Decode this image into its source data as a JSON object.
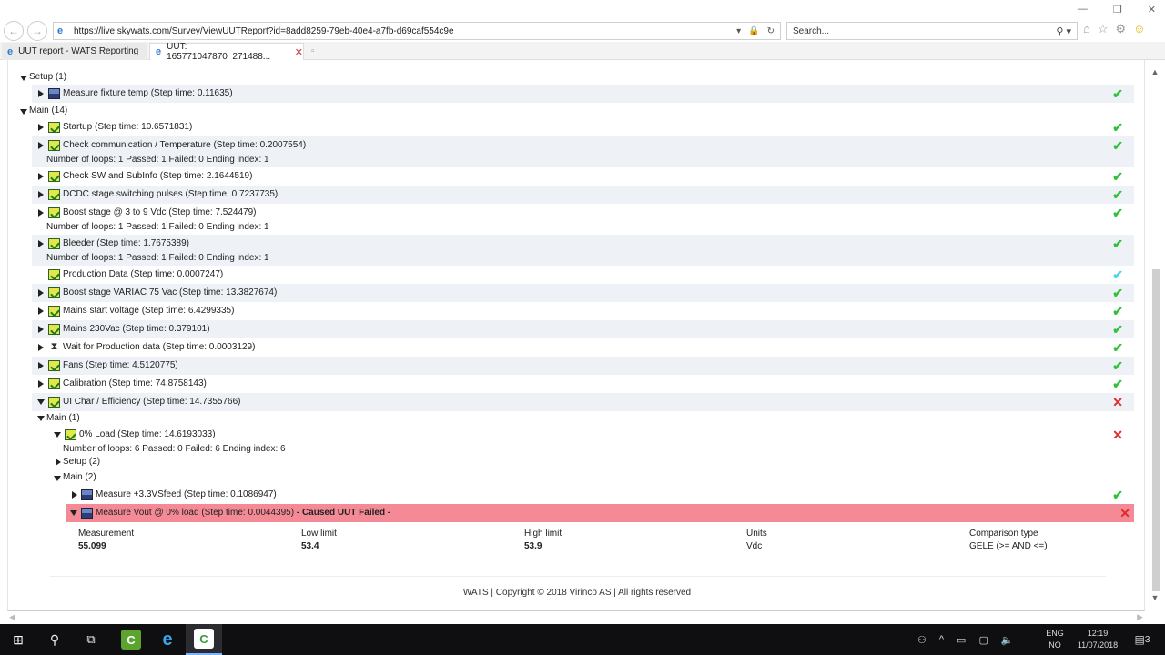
{
  "browser": {
    "url": "https://live.skywats.com/Survey/ViewUUTReport?id=8add8259-79eb-40e4-a7fb-d69caf554c9e",
    "search_placeholder": "Search...",
    "tabs": [
      {
        "label": "UUT report - WATS Reporting"
      },
      {
        "label": "UUT: 165771047870_271488..."
      }
    ]
  },
  "tree": {
    "setup_group": "Setup (1)",
    "setup_steps": [
      {
        "label": "Measure fixture temp (Step time: 0.11635)",
        "status": "passed"
      }
    ],
    "main_group": "Main (14)",
    "main_steps": [
      {
        "label": "Startup (Step time: 10.6571831)",
        "status": "passed"
      },
      {
        "label": "Check communication / Temperature (Step time: 0.2007554)",
        "status": "passed",
        "detail": "Number of loops: 1 Passed: 1 Failed: 0 Ending index: 1"
      },
      {
        "label": "Check SW and SubInfo (Step time: 2.1644519)",
        "status": "passed"
      },
      {
        "label": "DCDC stage switching pulses (Step time: 0.7237735)",
        "status": "passed"
      },
      {
        "label": "Boost stage @ 3 to 9 Vdc (Step time: 7.524479)",
        "status": "passed",
        "detail": "Number of loops: 1 Passed: 1 Failed: 0 Ending index: 1"
      },
      {
        "label": "Bleeder (Step time: 1.7675389)",
        "status": "passed",
        "detail": "Number of loops: 1 Passed: 1 Failed: 0 Ending index: 1"
      },
      {
        "label": "Production Data (Step time: 0.0007247)",
        "status": "done"
      },
      {
        "label": "Boost stage VARIAC 75 Vac (Step time: 13.3827674)",
        "status": "passed"
      },
      {
        "label": "Mains start voltage (Step time: 6.4299335)",
        "status": "passed"
      },
      {
        "label": "Mains 230Vac (Step time: 0.379101)",
        "status": "passed"
      },
      {
        "label": "Wait for Production data (Step time: 0.0003129)",
        "status": "passed"
      },
      {
        "label": "Fans (Step time: 4.5120775)",
        "status": "passed"
      },
      {
        "label": "Calibration (Step time: 74.8758143)",
        "status": "passed"
      },
      {
        "label": "UI Char / Efficiency (Step time: 14.7355766)",
        "status": "failed"
      }
    ],
    "nested": {
      "main_group": "Main (1)",
      "load_step": {
        "label": "0% Load (Step time: 14.6193033)",
        "status": "failed",
        "detail": "Number of loops: 6 Passed: 0 Failed: 6 Ending index: 6"
      },
      "setup_group": "Setup (2)",
      "inner_main_group": "Main (2)",
      "measure_33": {
        "label": "Measure +3.3VSfeed (Step time: 0.1086947)",
        "status": "passed"
      },
      "measure_vout": {
        "label": "Measure Vout @ 0% load (Step time: 0.0044395)",
        "suffix": " - Caused UUT Failed - ",
        "status": "failed"
      }
    }
  },
  "measurement": {
    "headers": [
      "Measurement",
      "Low limit",
      "High limit",
      "Units",
      "Comparison type"
    ],
    "values": [
      "55.099",
      "53.4",
      "53.9",
      "Vdc",
      "GELE (>= AND <=)"
    ]
  },
  "footer": "WATS | Copyright © 2018 Virinco AS | All rights reserved",
  "status_symbols": {
    "passed": "✔",
    "failed": "✕"
  },
  "colors": {
    "pass": "#30c23a",
    "fail": "#e02a2a",
    "fail_row": "#f38a96"
  },
  "taskbar": {
    "lang_top": "ENG",
    "lang_bottom": "NO",
    "time": "12:19",
    "date": "11/07/2018",
    "notif_count": "3"
  }
}
